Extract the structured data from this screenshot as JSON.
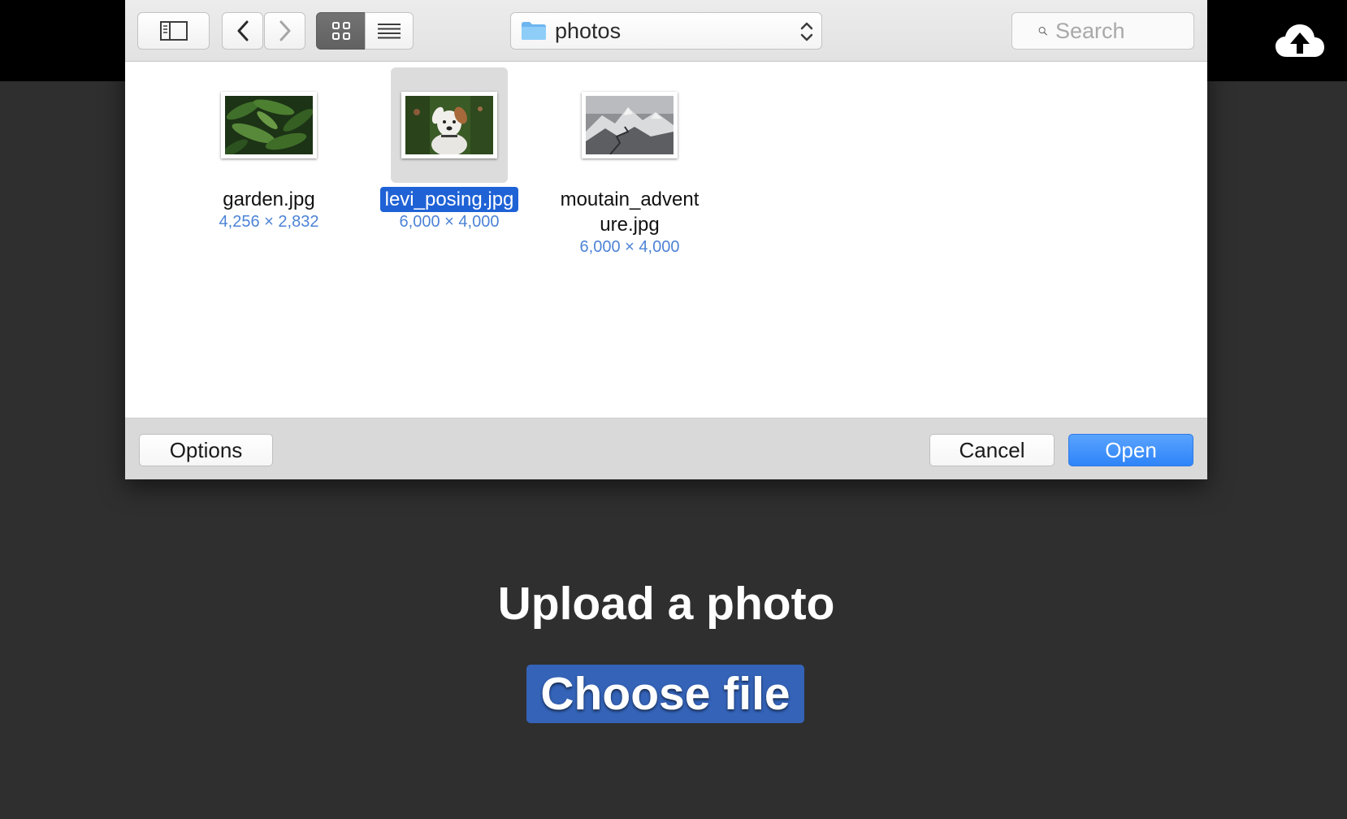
{
  "dialog": {
    "location": "photos",
    "search_placeholder": "Search",
    "view_mode": "icons",
    "files": [
      {
        "name": "garden.jpg",
        "dimensions": "4,256 × 2,832",
        "selected": false,
        "thumbnail": "green fern leaves"
      },
      {
        "name": "levi_posing.jpg",
        "dimensions": "6,000 × 4,000",
        "selected": true,
        "thumbnail": "white dog in garden"
      },
      {
        "name": "moutain_adventure.jpg",
        "dimensions": "6,000 × 4,000",
        "selected": false,
        "thumbnail": "snowy mountain landscape"
      }
    ],
    "options_label": "Options",
    "cancel_label": "Cancel",
    "open_label": "Open"
  },
  "page": {
    "upload_title": "Upload a photo",
    "choose_file_label": "Choose file",
    "upload_icon": "cloud-upload-icon"
  },
  "colors": {
    "page_background": "#2f2f2f",
    "top_bar": "#000000",
    "selection": "#1f62d6",
    "primary_button": "#2e84f8",
    "choose_file_button": "#3463b8",
    "dimension_text": "#4d83d6"
  }
}
